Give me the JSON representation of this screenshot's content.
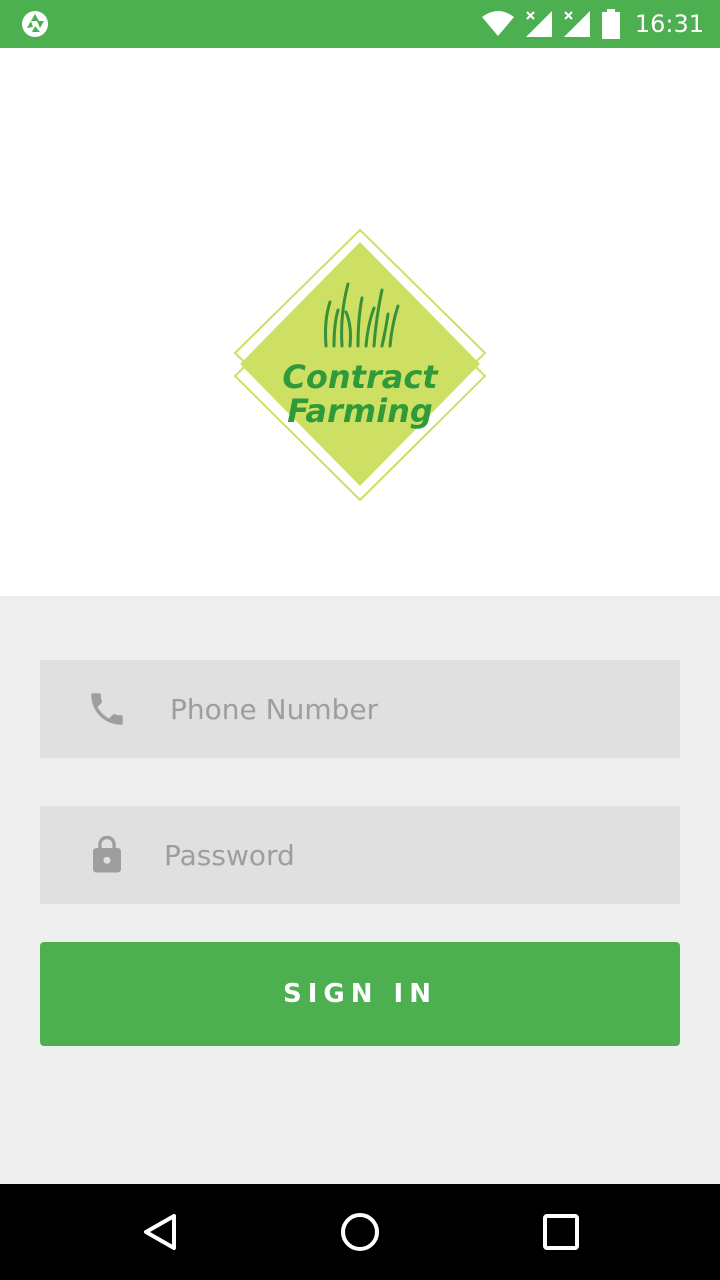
{
  "status_bar": {
    "time": "16:31",
    "icons": [
      "shutter-icon",
      "wifi-icon",
      "signal-icon",
      "signal-icon",
      "battery-icon"
    ]
  },
  "logo": {
    "line1": "Contract",
    "line2": "Farming",
    "colors": {
      "diamond": "#cde063",
      "outline": "#c4dd52",
      "text": "#2e9a3a",
      "grass": "#3a8f3a"
    }
  },
  "form": {
    "phone": {
      "placeholder": "Phone Number",
      "value": "",
      "icon": "phone-icon"
    },
    "password": {
      "placeholder": "Password",
      "value": "",
      "icon": "lock-icon"
    },
    "signin_label": "SIGN IN"
  },
  "nav": {
    "icons": [
      "back-icon",
      "home-icon",
      "recents-icon"
    ]
  },
  "colors": {
    "accent": "#4caf50",
    "form_bg": "#eeeeee",
    "field_bg": "#e0e0e0",
    "placeholder": "#9e9e9e"
  }
}
